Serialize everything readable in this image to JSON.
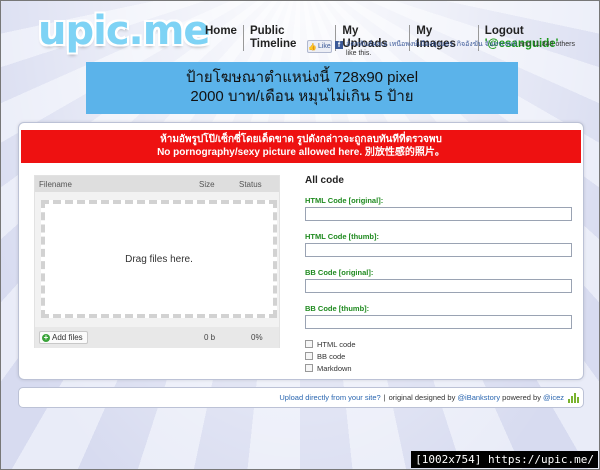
{
  "site": {
    "logo": "upic.me"
  },
  "nav": {
    "home": "Home",
    "public_timeline": "Public Timeline",
    "my_uploads": "My Uploads",
    "my_images": "My Images",
    "logout": "Logout",
    "username": "'@esanguide'"
  },
  "facebook": {
    "like_button": "Like",
    "names": "อัครพันธ์ผลเอ เหนือพงษ์เมืองยุ่งนธร, กิจอังฆัน จันทรเจษย์",
    "others": "and 11,843 others like this."
  },
  "ad": {
    "line1": "ป้ายโฆษณาตำแหน่งนี้ 728x90 pixel",
    "line2": "2000 บาท/เดือน หมุนไม่เกิน 5 ป้าย"
  },
  "warning": {
    "line_th": "ห้ามอัพรูปโป๊/เซ็กซี่โดยเด็ดขาด รูปดังกล่าวจะถูกลบทันทีที่ตรวจพบ",
    "line_en": "No pornography/sexy picture allowed here. 別放性感的照片。"
  },
  "uploader": {
    "col_filename": "Filename",
    "col_size": "Size",
    "col_status": "Status",
    "dropzone_text": "Drag files here.",
    "add_files": "Add files",
    "total_size": "0 b",
    "total_status": "0%"
  },
  "codes": {
    "title": "All code",
    "html_original": "HTML Code [original]:",
    "html_thumb": "HTML Code [thumb]:",
    "bb_original": "BB Code [original]:",
    "bb_thumb": "BB Code [thumb]:",
    "values": {
      "html_original": "",
      "html_thumb": "",
      "bb_original": "",
      "bb_thumb": ""
    },
    "options": [
      "HTML code",
      "BB code",
      "Markdown"
    ]
  },
  "footer": {
    "upload_link": "Upload directly from your site?",
    "original_text": "original designed by",
    "designer": "@iBankstory",
    "powered_text": "powered by",
    "powered_by": "@icez"
  },
  "watermark": "[1002x754] https://upic.me/",
  "colors": {
    "logo": "#7ed3f5",
    "ad_background": "#5bb3ea",
    "warning_background": "#ee1111",
    "code_label": "#1f8a1f",
    "link": "#2a66b0"
  }
}
